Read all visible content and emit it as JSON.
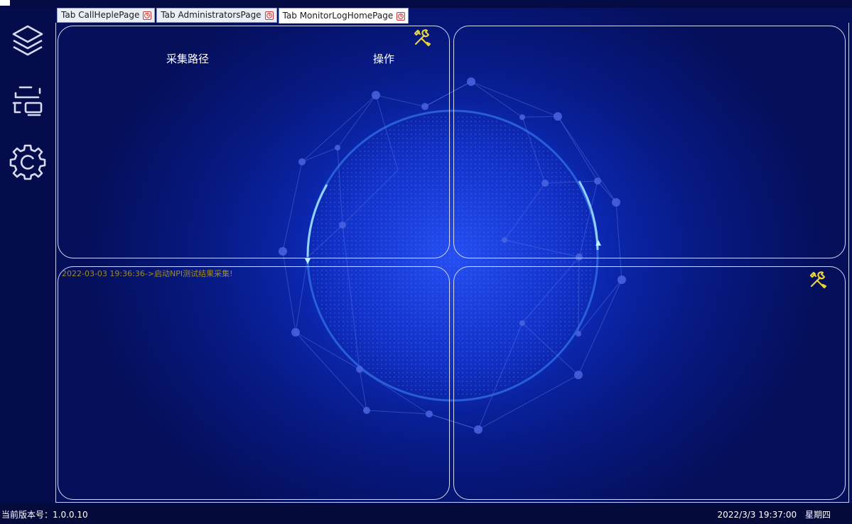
{
  "tabs": [
    {
      "label": "Tab CallHeplePage",
      "active": false
    },
    {
      "label": "Tab AdministratorsPage",
      "active": false
    },
    {
      "label": "Tab MonitorLogHomePage",
      "active": true
    }
  ],
  "sidebar": {
    "items": [
      {
        "icon": "layers-icon"
      },
      {
        "icon": "scan-icon"
      },
      {
        "icon": "settings-gear-icon"
      }
    ]
  },
  "panels": {
    "top_left": {
      "col_path": "采集路径",
      "col_action": "操作",
      "tool_icon": "tools-icon"
    },
    "bottom_left": {
      "log": "2022-03-03 19:36:36->启动NPI测试结果采集!"
    },
    "bottom_right": {
      "tool_icon": "tools-icon"
    }
  },
  "status": {
    "version_label": "当前版本号：1.0.0.10",
    "datetime": "2022/3/3 19:37:00",
    "weekday": "星期四"
  },
  "colors": {
    "background": "#0c2ab8",
    "sidebar": "#040c4c",
    "panel_border": "#d2daf6",
    "log_text": "#9e8a2e",
    "tool_icon": "#e8d43a"
  }
}
